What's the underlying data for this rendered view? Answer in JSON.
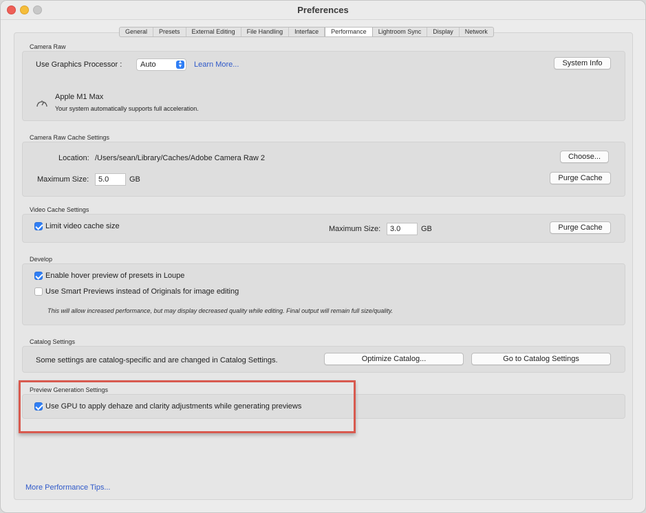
{
  "window": {
    "title": "Preferences"
  },
  "tabs": [
    {
      "label": "General"
    },
    {
      "label": "Presets"
    },
    {
      "label": "External Editing"
    },
    {
      "label": "File Handling"
    },
    {
      "label": "Interface"
    },
    {
      "label": "Performance",
      "active": true
    },
    {
      "label": "Lightroom Sync"
    },
    {
      "label": "Display"
    },
    {
      "label": "Network"
    }
  ],
  "camera_raw": {
    "section_label": "Camera Raw",
    "gpu_label": "Use Graphics Processor :",
    "gpu_value": "Auto",
    "learn_more": "Learn More...",
    "system_info": "System Info",
    "gpu_name": "Apple M1 Max",
    "gpu_status": "Your system automatically supports full acceleration."
  },
  "cache": {
    "section_label": "Camera Raw Cache Settings",
    "location_label": "Location:",
    "location_value": "/Users/sean/Library/Caches/Adobe Camera Raw 2",
    "choose": "Choose...",
    "max_size_label": "Maximum Size:",
    "max_size_value": "5.0",
    "unit": "GB",
    "purge": "Purge Cache"
  },
  "video_cache": {
    "section_label": "Video Cache Settings",
    "limit_label": "Limit video cache size",
    "limit_checked": true,
    "max_size_label": "Maximum Size:",
    "max_size_value": "3.0",
    "unit": "GB",
    "purge": "Purge Cache"
  },
  "develop": {
    "section_label": "Develop",
    "hover_label": "Enable hover preview of presets in Loupe",
    "hover_checked": true,
    "smart_label": "Use Smart Previews instead of Originals for image editing",
    "smart_checked": false,
    "note": "This will allow increased performance, but may display decreased quality while editing. Final output will remain full size/quality."
  },
  "catalog": {
    "section_label": "Catalog Settings",
    "description": "Some settings are catalog-specific and are changed in Catalog Settings.",
    "optimize": "Optimize Catalog...",
    "goto": "Go to Catalog Settings"
  },
  "preview": {
    "section_label": "Preview Generation Settings",
    "gpu_label": "Use GPU to apply dehaze and clarity adjustments while generating previews",
    "gpu_checked": true
  },
  "footer": {
    "tips_link": "More Performance Tips..."
  },
  "colors": {
    "accent": "#2f7ef5",
    "link": "#2f59c9",
    "highlight": "#d85a4f"
  }
}
